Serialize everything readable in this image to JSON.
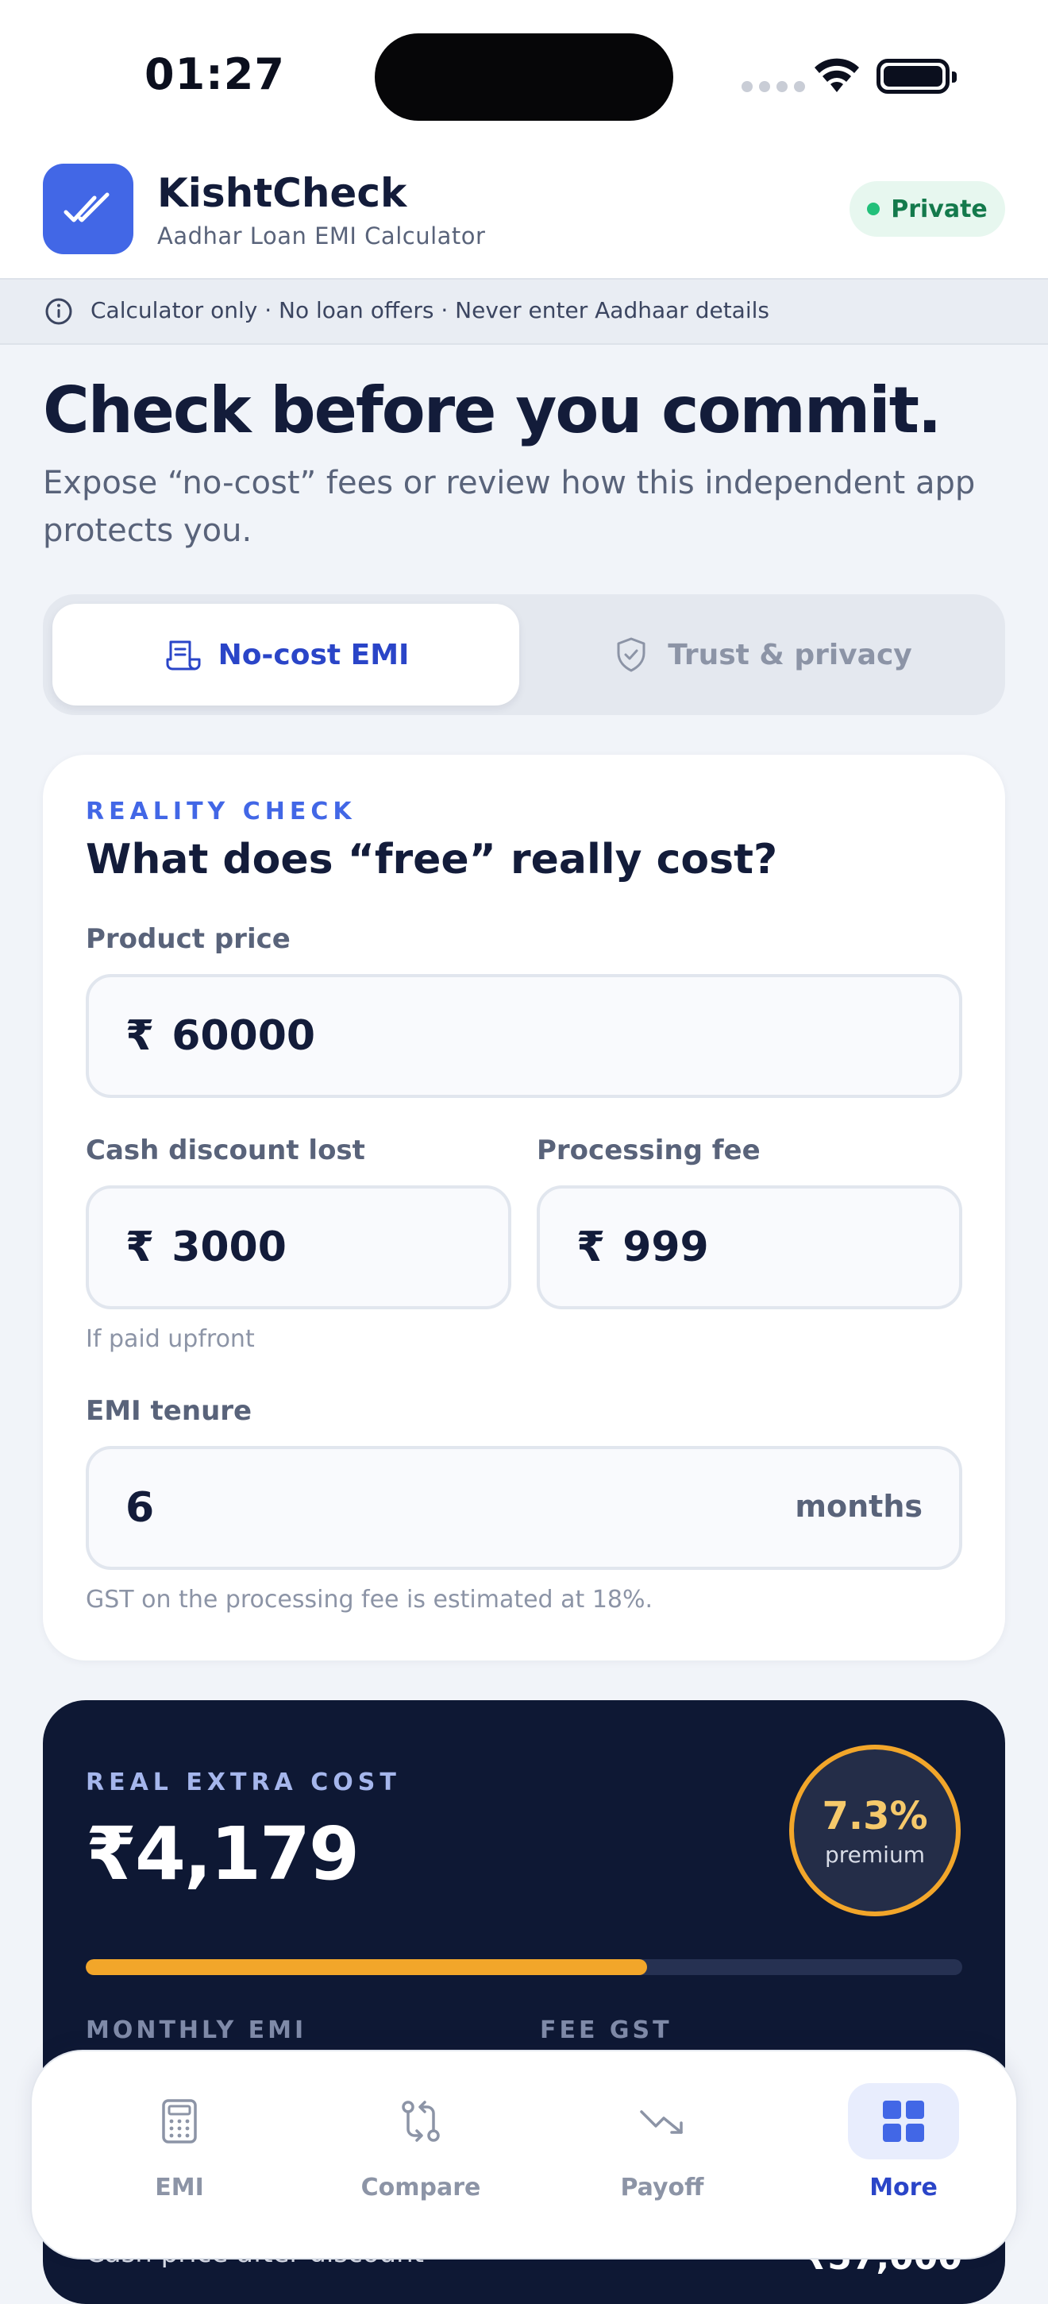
{
  "status_bar": {
    "time": "01:27"
  },
  "header": {
    "app_name": "KishtCheck",
    "subtitle": "Aadhar Loan EMI Calculator",
    "badge": "Private",
    "colors": {
      "brand": "#4267e6",
      "badge_bg": "#e7f7ef",
      "badge_text": "#147a4c"
    }
  },
  "notice": {
    "icon": "info-icon",
    "text": "Calculator only · No loan offers · Never enter Aadhaar details"
  },
  "hero": {
    "title": "Check before you commit.",
    "subtitle": "Expose “no-cost” fees or review how this independent app protects you."
  },
  "tabs": [
    {
      "label": "No-cost EMI",
      "icon": "receipt-icon",
      "active": true
    },
    {
      "label": "Trust & privacy",
      "icon": "shield-check-icon",
      "active": false
    }
  ],
  "calculator": {
    "eyebrow": "REALITY CHECK",
    "title": "What does “free” really cost?",
    "currency": "₹",
    "product_price": {
      "label": "Product price",
      "value": "60000"
    },
    "cash_discount": {
      "label": "Cash discount lost",
      "value": "3000",
      "hint": "If paid upfront"
    },
    "processing_fee": {
      "label": "Processing fee",
      "value": "999"
    },
    "tenure": {
      "label": "EMI tenure",
      "value": "6",
      "suffix": "months"
    },
    "footnote": "GST on the processing fee is estimated at 18%."
  },
  "result": {
    "eyebrow": "REAL EXTRA COST",
    "value": "₹4,179",
    "premium_pct": "7.3%",
    "premium_label": "premium",
    "progress_fraction": 0.64,
    "col1_label": "MONTHLY EMI",
    "col2_label": "FEE GST",
    "row_label": "Cash price after discount",
    "row_value": "₹57,000",
    "colors": {
      "bg": "#0e1834",
      "accent": "#f2a62a"
    }
  },
  "bottom_nav": [
    {
      "label": "EMI",
      "icon": "calculator-icon",
      "active": false
    },
    {
      "label": "Compare",
      "icon": "compare-arrows-icon",
      "active": false
    },
    {
      "label": "Payoff",
      "icon": "trend-down-icon",
      "active": false
    },
    {
      "label": "More",
      "icon": "grid-icon",
      "active": true
    }
  ]
}
